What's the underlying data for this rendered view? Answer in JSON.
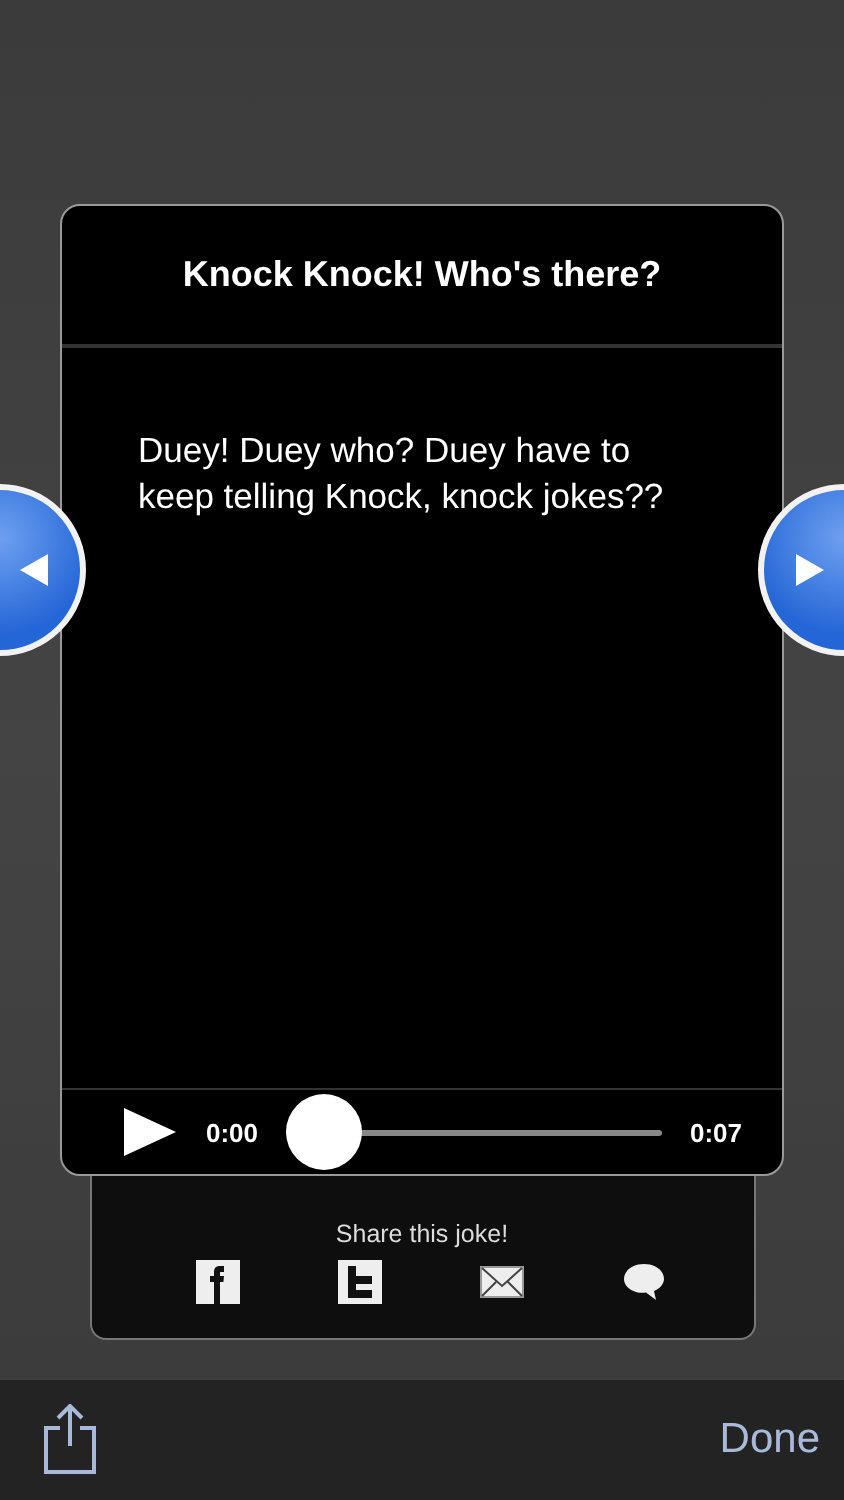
{
  "card": {
    "title": "Knock Knock! Who's there?",
    "joke": "Duey! Duey who? Duey have to keep telling Knock, knock jokes??"
  },
  "player": {
    "elapsed": "0:00",
    "duration": "0:07",
    "level": 0
  },
  "share": {
    "label": "Share this joke!"
  },
  "toolbar": {
    "done": "Done"
  }
}
